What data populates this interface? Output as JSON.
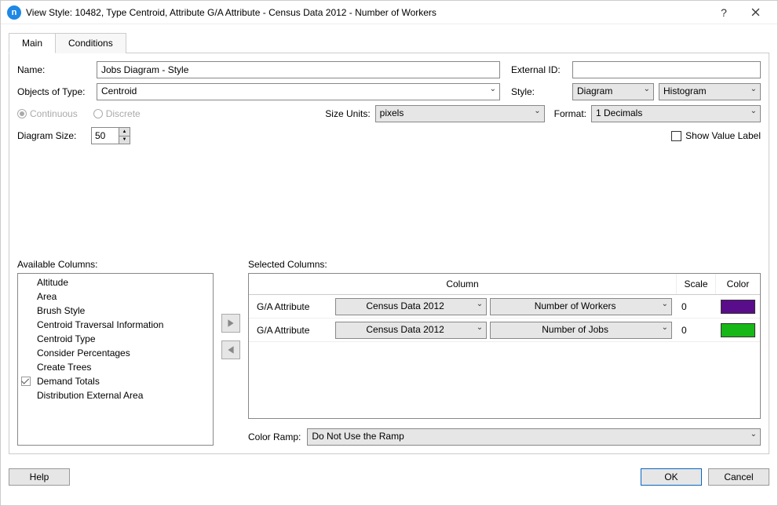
{
  "window": {
    "title": "View Style: 10482, Type Centroid, Attribute G/A Attribute - Census Data 2012 - Number of Workers"
  },
  "tabs": {
    "main": "Main",
    "conditions": "Conditions"
  },
  "fields": {
    "name_label": "Name:",
    "name_value": "Jobs Diagram - Style",
    "externalid_label": "External ID:",
    "externalid_value": "",
    "objects_label": "Objects of Type:",
    "objects_value": "Centroid",
    "style_label": "Style:",
    "style_value": "Diagram",
    "style_sub_value": "Histogram",
    "continuous": "Continuous",
    "discrete": "Discrete",
    "size_units_label": "Size Units:",
    "size_units_value": "pixels",
    "format_label": "Format:",
    "format_value": "1 Decimals",
    "diagram_size_label": "Diagram Size:",
    "diagram_size_value": "50",
    "show_value_label": "Show Value Label"
  },
  "lists": {
    "available_label": "Available Columns:",
    "available": [
      {
        "label": "Altitude"
      },
      {
        "label": "Area"
      },
      {
        "label": "Brush Style"
      },
      {
        "label": "Centroid Traversal Information"
      },
      {
        "label": "Centroid Type"
      },
      {
        "label": "Consider Percentages"
      },
      {
        "label": "Create Trees"
      },
      {
        "label": "Demand Totals",
        "checked": true
      },
      {
        "label": "Distribution External Area"
      }
    ],
    "selected_label": "Selected Columns:",
    "grid_headers": {
      "column": "Column",
      "scale": "Scale",
      "color": "Color"
    },
    "selected_rows": [
      {
        "col_name": "G/A Attribute",
        "census": "Census Data 2012",
        "attr": "Number of Workers",
        "scale": "0",
        "color": "#5a0d8a"
      },
      {
        "col_name": "G/A Attribute",
        "census": "Census Data 2012",
        "attr": "Number of Jobs",
        "scale": "0",
        "color": "#16b716"
      }
    ],
    "color_ramp_label": "Color Ramp:",
    "color_ramp_value": "Do Not Use the Ramp"
  },
  "buttons": {
    "help": "Help",
    "ok": "OK",
    "cancel": "Cancel"
  }
}
